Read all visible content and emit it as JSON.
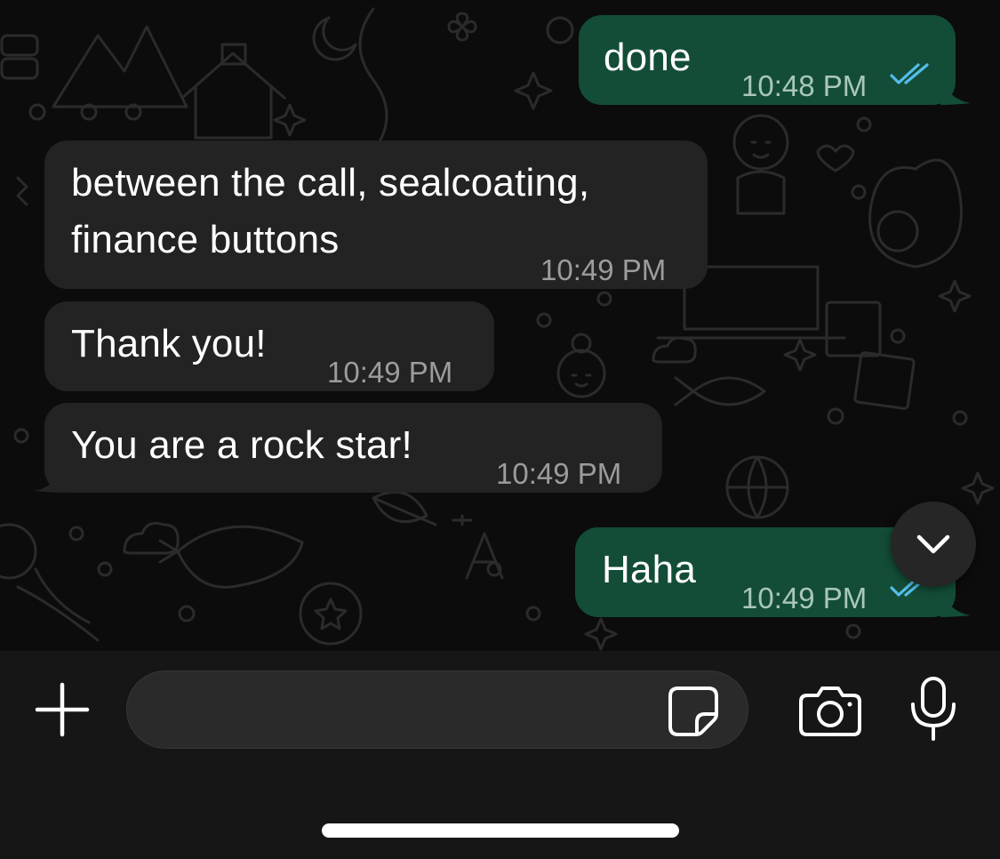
{
  "chat": {
    "messages": [
      {
        "direction": "outgoing",
        "text": "done",
        "time": "10:48 PM",
        "status": "read"
      },
      {
        "direction": "incoming",
        "text": "between the call, sealcoating,\nfinance buttons",
        "time": "10:49 PM"
      },
      {
        "direction": "incoming",
        "text": "Thank you!",
        "time": "10:49 PM"
      },
      {
        "direction": "incoming",
        "text": "You are a rock star!",
        "time": "10:49 PM"
      },
      {
        "direction": "outgoing",
        "text": "Haha",
        "time": "10:49 PM",
        "status": "read"
      }
    ]
  },
  "scroll_button": {
    "icon": "chevron-down-icon"
  },
  "composer": {
    "input_value": "",
    "icons": [
      "plus-icon",
      "sticker-icon",
      "camera-icon",
      "microphone-icon"
    ]
  },
  "colors": {
    "incoming_bubble": "#232323",
    "outgoing_bubble": "#134d37",
    "read_ticks": "#53bdeb",
    "background": "#0c0c0c"
  }
}
